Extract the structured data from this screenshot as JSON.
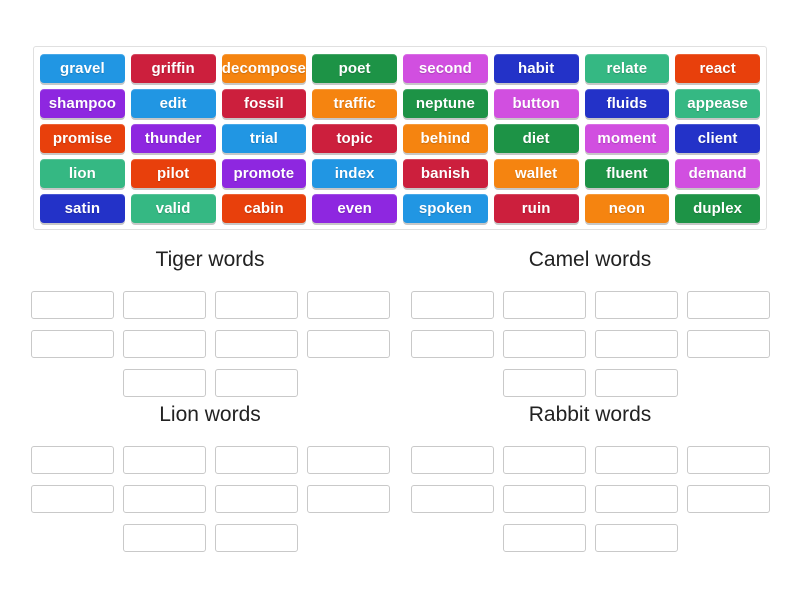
{
  "activity": {
    "type": "group-sort",
    "background_color": "#ffffff"
  },
  "word_bank": {
    "name": "word-bank",
    "border_color": "#e0e0e0",
    "palette": {
      "blue_light": "#2196e3",
      "blue_dark": "#2332c8",
      "red": "#cc1f3d",
      "orange": "#f58410",
      "orange_dark": "#e8400c",
      "green_dark": "#1d9346",
      "green_light": "#35b883",
      "purple": "#8e27e0",
      "magenta": "#d14fe0"
    },
    "rows": [
      [
        {
          "text": "gravel",
          "color": "#2196e3"
        },
        {
          "text": "griffin",
          "color": "#cc1f3d"
        },
        {
          "text": "decompose",
          "color": "#f58410"
        },
        {
          "text": "poet",
          "color": "#1d9346"
        },
        {
          "text": "second",
          "color": "#d14fe0"
        },
        {
          "text": "habit",
          "color": "#2332c8"
        },
        {
          "text": "relate",
          "color": "#35b883"
        },
        {
          "text": "react",
          "color": "#e8400c"
        }
      ],
      [
        {
          "text": "shampoo",
          "color": "#8e27e0"
        },
        {
          "text": "edit",
          "color": "#2196e3"
        },
        {
          "text": "fossil",
          "color": "#cc1f3d"
        },
        {
          "text": "traffic",
          "color": "#f58410"
        },
        {
          "text": "neptune",
          "color": "#1d9346"
        },
        {
          "text": "button",
          "color": "#d14fe0"
        },
        {
          "text": "fluids",
          "color": "#2332c8"
        },
        {
          "text": "appease",
          "color": "#35b883"
        }
      ],
      [
        {
          "text": "promise",
          "color": "#e8400c"
        },
        {
          "text": "thunder",
          "color": "#8e27e0"
        },
        {
          "text": "trial",
          "color": "#2196e3"
        },
        {
          "text": "topic",
          "color": "#cc1f3d"
        },
        {
          "text": "behind",
          "color": "#f58410"
        },
        {
          "text": "diet",
          "color": "#1d9346"
        },
        {
          "text": "moment",
          "color": "#d14fe0"
        },
        {
          "text": "client",
          "color": "#2332c8"
        }
      ],
      [
        {
          "text": "lion",
          "color": "#35b883"
        },
        {
          "text": "pilot",
          "color": "#e8400c"
        },
        {
          "text": "promote",
          "color": "#8e27e0"
        },
        {
          "text": "index",
          "color": "#2196e3"
        },
        {
          "text": "banish",
          "color": "#cc1f3d"
        },
        {
          "text": "wallet",
          "color": "#f58410"
        },
        {
          "text": "fluent",
          "color": "#1d9346"
        },
        {
          "text": "demand",
          "color": "#d14fe0"
        }
      ],
      [
        {
          "text": "satin",
          "color": "#2332c8"
        },
        {
          "text": "valid",
          "color": "#35b883"
        },
        {
          "text": "cabin",
          "color": "#e8400c"
        },
        {
          "text": "even",
          "color": "#8e27e0"
        },
        {
          "text": "spoken",
          "color": "#2196e3"
        },
        {
          "text": "ruin",
          "color": "#cc1f3d"
        },
        {
          "text": "neon",
          "color": "#f58410"
        },
        {
          "text": "duplex",
          "color": "#1d9346"
        }
      ]
    ]
  },
  "groups": [
    {
      "title": "Tiger words",
      "slot_rows": [
        4,
        4,
        2
      ],
      "slots_filled": []
    },
    {
      "title": "Camel words",
      "slot_rows": [
        4,
        4,
        2
      ],
      "slots_filled": []
    },
    {
      "title": "Lion words",
      "slot_rows": [
        4,
        4,
        2
      ],
      "slots_filled": []
    },
    {
      "title": "Rabbit words",
      "slot_rows": [
        4,
        4,
        2
      ],
      "slots_filled": []
    }
  ]
}
